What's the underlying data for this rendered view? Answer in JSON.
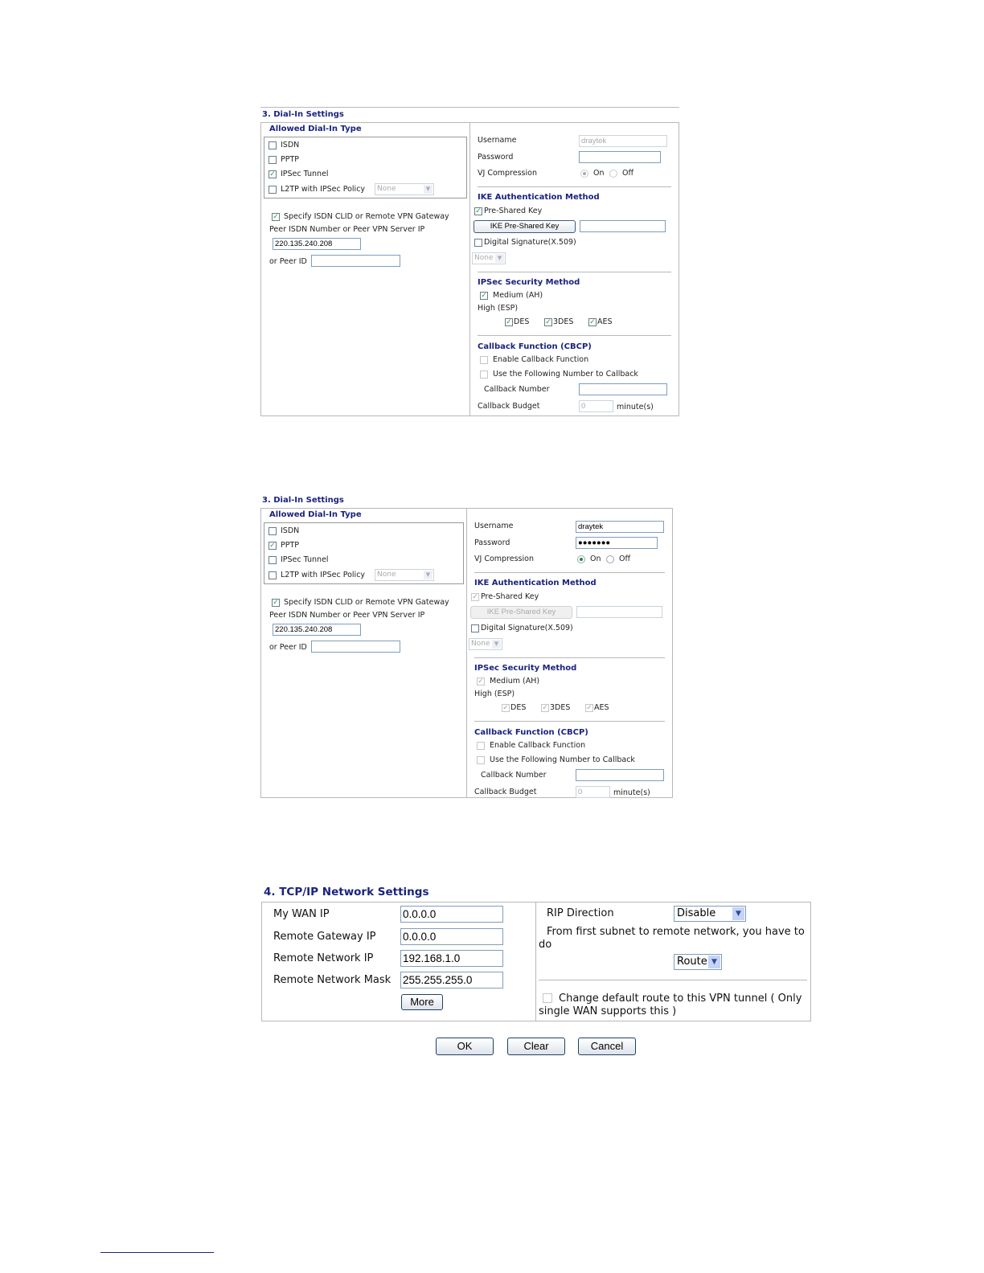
{
  "panels": [
    {
      "section_title": "3. Dial-In Settings",
      "allowed_title": "Allowed Dial-In Type",
      "types": [
        {
          "label": "ISDN",
          "checked": false
        },
        {
          "label": "PPTP",
          "checked": false
        },
        {
          "label": "IPSec Tunnel",
          "checked": true
        },
        {
          "label": "L2TP with IPSec Policy",
          "checked": false
        }
      ],
      "l2tp_policy": "None",
      "specify_label": "Specify ISDN CLID or Remote VPN Gateway",
      "specify_checked": true,
      "peer_label": "Peer ISDN Number or Peer VPN Server IP",
      "peer_value": "220.135.240.208",
      "peer_id_label": "or Peer ID",
      "peer_id_value": "",
      "username_label": "Username",
      "username_value": "draytek",
      "username_disabled": true,
      "password_label": "Password",
      "password_value": "",
      "vj_label": "VJ Compression",
      "vj_on": "On",
      "vj_off": "Off",
      "vj_value": "On",
      "vj_disabled": true,
      "ike_title": "IKE Authentication Method",
      "psk_label": "Pre-Shared Key",
      "psk_checked": true,
      "psk_disabled": false,
      "psk_button": "IKE Pre-Shared Key",
      "psk_value": "",
      "ds_label": "Digital Signature(X.509)",
      "ds_checked": false,
      "ds_select": "None",
      "ipsec_title": "IPSec Security Method",
      "medium_label": "Medium (AH)",
      "medium_checked": true,
      "high_label": "High (ESP)",
      "esp": [
        {
          "label": "DES",
          "checked": true
        },
        {
          "label": "3DES",
          "checked": true
        },
        {
          "label": "AES",
          "checked": true
        }
      ],
      "ipsec_disabled": false,
      "cb_title": "Callback Function (CBCP)",
      "cb_enable_label": "Enable Callback Function",
      "cb_use_label": "Use the Following Number to Callback",
      "cb_number_label": "Callback Number",
      "cb_number_value": "",
      "cb_budget_label": "Callback Budget",
      "cb_budget_value": "0",
      "cb_budget_unit": "minute(s)"
    },
    {
      "section_title": "3. Dial-In Settings",
      "allowed_title": "Allowed Dial-In Type",
      "types": [
        {
          "label": "ISDN",
          "checked": false
        },
        {
          "label": "PPTP",
          "checked": true
        },
        {
          "label": "IPSec Tunnel",
          "checked": false
        },
        {
          "label": "L2TP with IPSec Policy",
          "checked": false
        }
      ],
      "l2tp_policy": "None",
      "specify_label": "Specify ISDN CLID or Remote VPN Gateway",
      "specify_checked": true,
      "peer_label": "Peer ISDN Number or Peer VPN Server IP",
      "peer_value": "220.135.240.208",
      "peer_id_label": "or Peer ID",
      "peer_id_value": "",
      "username_label": "Username",
      "username_value": "draytek",
      "username_disabled": false,
      "password_label": "Password",
      "password_value": "●●●●●●●",
      "vj_label": "VJ Compression",
      "vj_on": "On",
      "vj_off": "Off",
      "vj_value": "On",
      "vj_disabled": false,
      "ike_title": "IKE Authentication Method",
      "psk_label": "Pre-Shared Key",
      "psk_checked": true,
      "psk_disabled": true,
      "psk_button": "IKE Pre-Shared Key",
      "psk_value": "",
      "ds_label": "Digital Signature(X.509)",
      "ds_checked": false,
      "ds_select": "None",
      "ipsec_title": "IPSec Security Method",
      "medium_label": "Medium (AH)",
      "medium_checked": true,
      "high_label": "High (ESP)",
      "esp": [
        {
          "label": "DES",
          "checked": true
        },
        {
          "label": "3DES",
          "checked": true
        },
        {
          "label": "AES",
          "checked": true
        }
      ],
      "ipsec_disabled": true,
      "cb_title": "Callback Function (CBCP)",
      "cb_enable_label": "Enable Callback Function",
      "cb_use_label": "Use the Following Number to Callback",
      "cb_number_label": "Callback Number",
      "cb_number_value": "",
      "cb_budget_label": "Callback Budget",
      "cb_budget_value": "0",
      "cb_budget_unit": "minute(s)"
    }
  ],
  "tcpip": {
    "title": "4. TCP/IP Network Settings",
    "fields": [
      {
        "label": "My WAN IP",
        "value": "0.0.0.0"
      },
      {
        "label": "Remote Gateway IP",
        "value": "0.0.0.0"
      },
      {
        "label": "Remote Network IP",
        "value": "192.168.1.0"
      },
      {
        "label": "Remote Network Mask",
        "value": "255.255.255.0"
      }
    ],
    "more_button": "More",
    "rip_label": "RIP Direction",
    "rip_value": "Disable",
    "subnet_text": "From first subnet to remote network, you have to do",
    "route_value": "Route",
    "default_route_label": "Change default route to this VPN tunnel ( Only single WAN supports this )",
    "default_route_checked": false
  },
  "buttons": {
    "ok": "OK",
    "clear": "Clear",
    "cancel": "Cancel"
  },
  "colors": {
    "title": "#1a237e",
    "check": "#2a9d2a",
    "border": "#b8b8b8"
  }
}
